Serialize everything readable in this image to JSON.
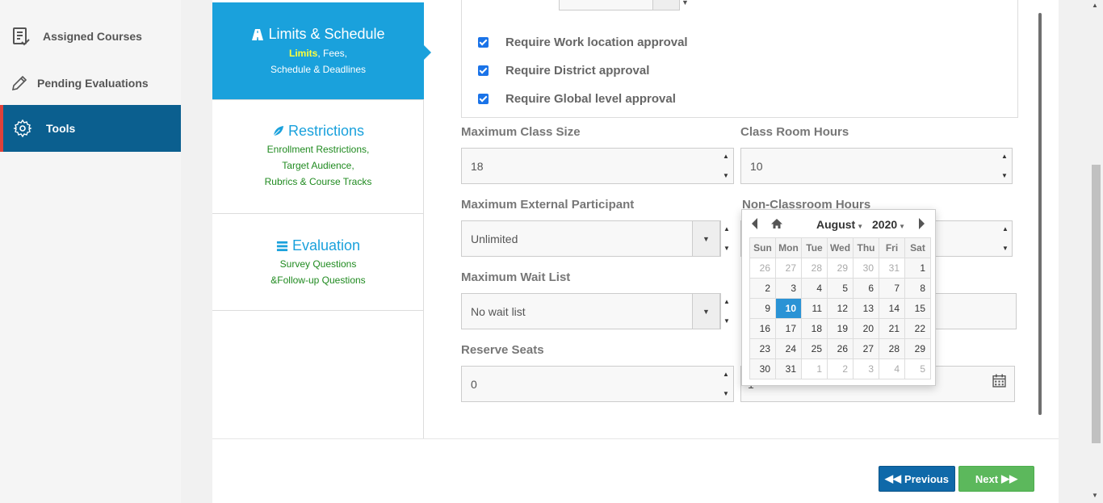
{
  "sidebar": {
    "items": [
      {
        "label": "Assigned Courses",
        "icon": "clipboard-icon"
      },
      {
        "label": "Pending Evaluations",
        "icon": "pencil-icon"
      },
      {
        "label": "Tools",
        "icon": "gear-icon",
        "active": true
      }
    ]
  },
  "steps": [
    {
      "title": "Limits & Schedule",
      "icon": "road-icon",
      "sub_highlight": "Limits",
      "sub_line1_rest": ", Fees,",
      "sub_line2": "Schedule & Deadlines"
    },
    {
      "title": "Restrictions",
      "icon": "leaf-icon",
      "sub_line1": "Enrollment Restrictions,",
      "sub_line2": "Target Audience,",
      "sub_line3": "Rubrics & Course Tracks"
    },
    {
      "title": "Evaluation",
      "icon": "list-icon",
      "sub_line1": "Survey Questions",
      "sub_line2": "&Follow-up Questions"
    }
  ],
  "approvals": [
    {
      "label": "Require Work location approval",
      "checked": true
    },
    {
      "label": "Require District approval",
      "checked": true
    },
    {
      "label": "Require Global level approval",
      "checked": true
    }
  ],
  "fields": {
    "max_class_size": {
      "label": "Maximum Class Size",
      "value": "18"
    },
    "class_room_hours": {
      "label": "Class Room Hours",
      "value": "10"
    },
    "max_external": {
      "label": "Maximum External Participant",
      "value": "Unlimited"
    },
    "non_classroom_hours": {
      "label": "Non-Classroom Hours"
    },
    "max_wait_list": {
      "label": "Maximum Wait List",
      "value": "No wait list"
    },
    "reserve_seats": {
      "label": "Reserve Seats",
      "value": "0"
    },
    "date_value": "1"
  },
  "datepicker": {
    "month": "August",
    "year": "2020",
    "weekdays": [
      "Sun",
      "Mon",
      "Tue",
      "Wed",
      "Thu",
      "Fri",
      "Sat"
    ],
    "weeks": [
      [
        "26",
        "27",
        "28",
        "29",
        "30",
        "31",
        "1"
      ],
      [
        "2",
        "3",
        "4",
        "5",
        "6",
        "7",
        "8"
      ],
      [
        "9",
        "10",
        "11",
        "12",
        "13",
        "14",
        "15"
      ],
      [
        "16",
        "17",
        "18",
        "19",
        "20",
        "21",
        "22"
      ],
      [
        "23",
        "24",
        "25",
        "26",
        "27",
        "28",
        "29"
      ],
      [
        "30",
        "31",
        "1",
        "2",
        "3",
        "4",
        "5"
      ]
    ],
    "selected": "10"
  },
  "buttons": {
    "previous": "Previous",
    "next": "Next"
  },
  "colors": {
    "accent": "#1aa1dc",
    "nav_active": "#0b5f8f",
    "next": "#5cb85c",
    "previous": "#0f69a9"
  }
}
